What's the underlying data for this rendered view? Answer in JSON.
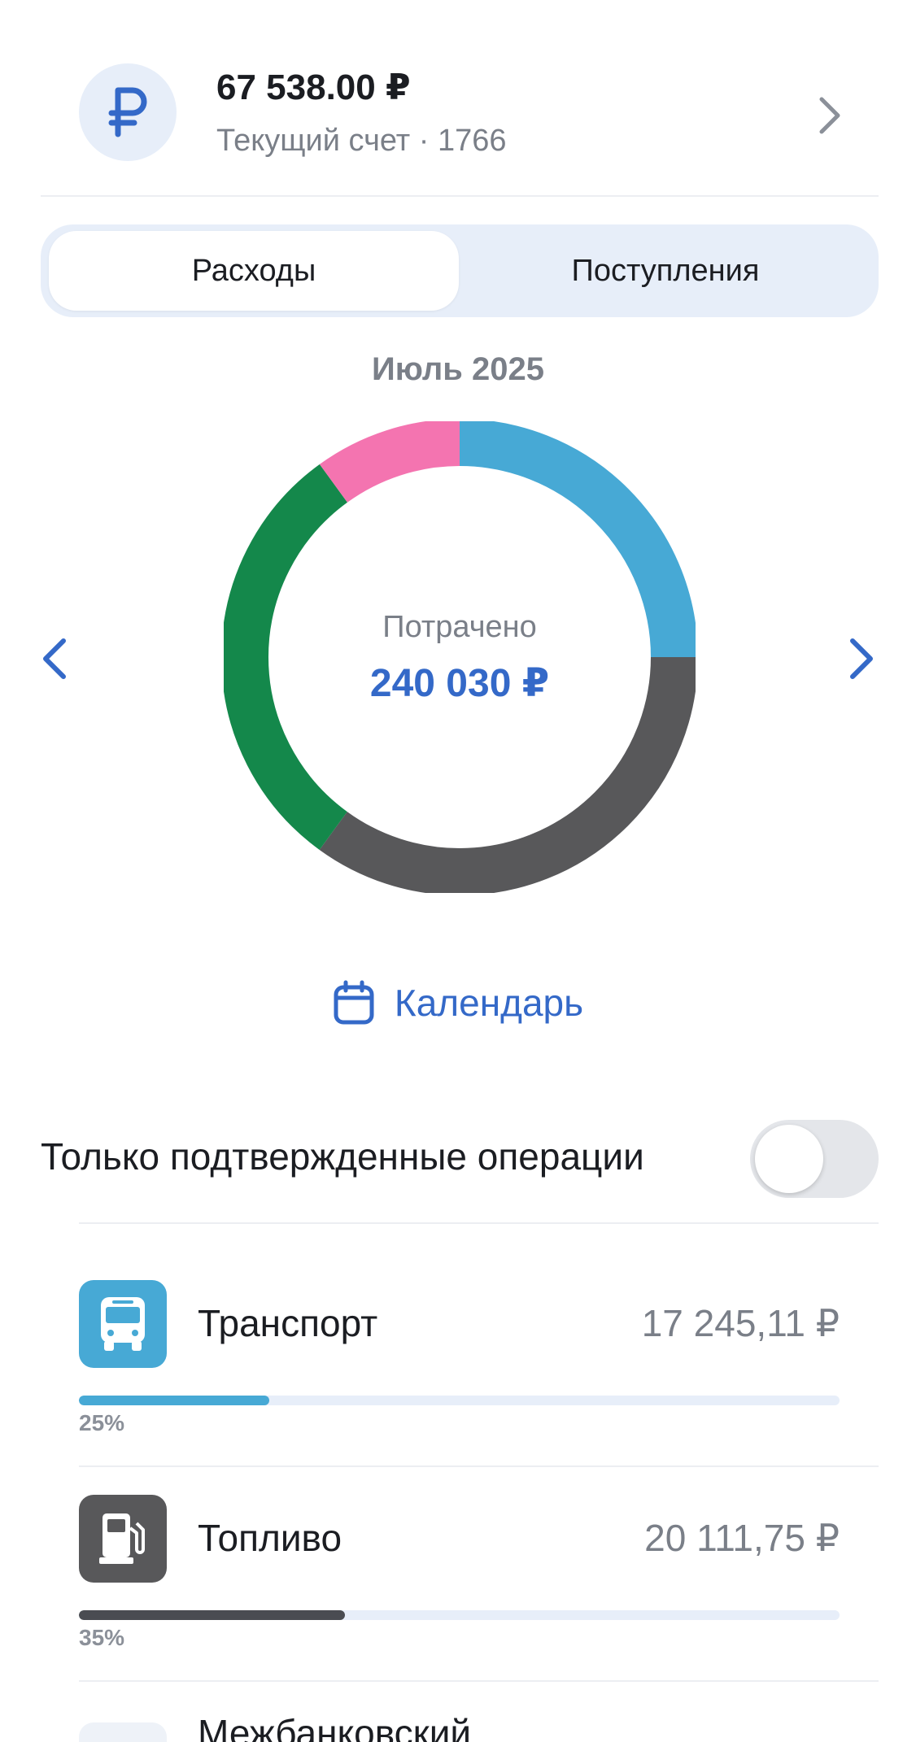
{
  "account": {
    "amount": "67 538.00 ₽",
    "subtitle": "Текущий счет · 1766",
    "avatar_icon": "ruble-icon",
    "chevron_icon": "chevron-right-icon"
  },
  "segmented": {
    "expenses": "Расходы",
    "income": "Поступления",
    "active": "expenses"
  },
  "period": {
    "month": "Июль 2025",
    "prev_icon": "chevron-left-icon",
    "next_icon": "chevron-right-icon"
  },
  "summary": {
    "spent_label": "Потрачено",
    "spent_value": "240 030 ₽"
  },
  "chart_data": {
    "type": "pie",
    "style": "donut",
    "categories": [
      "Транспорт",
      "Топливо",
      "",
      ""
    ],
    "values": [
      25,
      35,
      30,
      10
    ],
    "colors": [
      "#47a9d5",
      "#58585a",
      "#14884b",
      "#f474b0"
    ]
  },
  "calendar": {
    "label": "Календарь",
    "icon": "calendar-icon"
  },
  "filter": {
    "label": "Только подтвержденные операции",
    "enabled": false
  },
  "categories": [
    {
      "name": "Транспорт",
      "amount": "17 245,11 ₽",
      "percent_label": "25%",
      "percent": 25,
      "color": "#47a9d5",
      "icon": "bus-icon"
    },
    {
      "name": "Топливо",
      "amount": "20 111,75 ₽",
      "percent_label": "35%",
      "percent": 35,
      "color": "#4a4c52",
      "icon": "fuel-pump-icon"
    },
    {
      "name": "Межбанковский"
    }
  ]
}
